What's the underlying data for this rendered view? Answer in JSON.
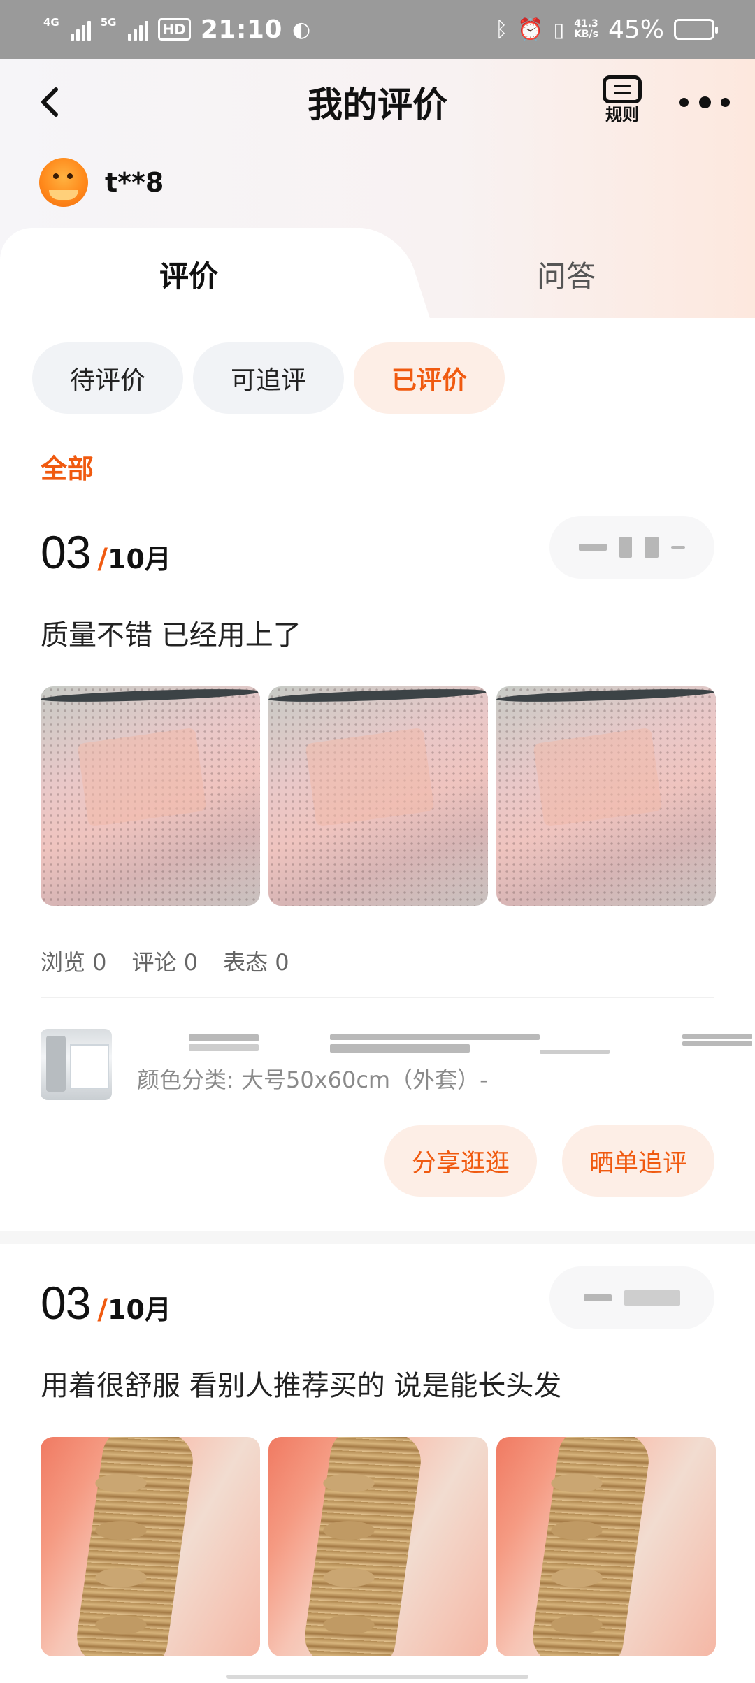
{
  "status_bar": {
    "signal1": "4G",
    "signal2": "5G",
    "hd": "HD",
    "time": "21:10",
    "net_speed_value": "41.3",
    "net_speed_unit": "KB/s",
    "battery": "45%",
    "battery_level": 0.45
  },
  "header": {
    "title": "我的评价",
    "rules_label": "规则",
    "username": "t**8"
  },
  "tabs": [
    {
      "label": "评价",
      "active": true
    },
    {
      "label": "问答",
      "active": false
    }
  ],
  "filters": [
    {
      "label": "待评价",
      "active": false
    },
    {
      "label": "可追评",
      "active": false
    },
    {
      "label": "已评价",
      "active": true
    }
  ],
  "sub_filter": "全部",
  "reviews": [
    {
      "day": "03",
      "slash": "/",
      "month": "10月",
      "text": "质量不错 已经用上了",
      "stats": [
        "浏览 0",
        "评论 0",
        "表态 0"
      ],
      "product_sku": "颜色分类: 大号50x60cm（外套）-",
      "actions": [
        "分享逛逛",
        "晒单追评"
      ]
    },
    {
      "day": "03",
      "slash": "/",
      "month": "10月",
      "text": "用着很舒服 看别人推荐买的 说是能长头发"
    }
  ],
  "colors": {
    "accent": "#f05a10",
    "accent_bg": "#fdeee6",
    "chip_bg": "#f1f3f6"
  }
}
